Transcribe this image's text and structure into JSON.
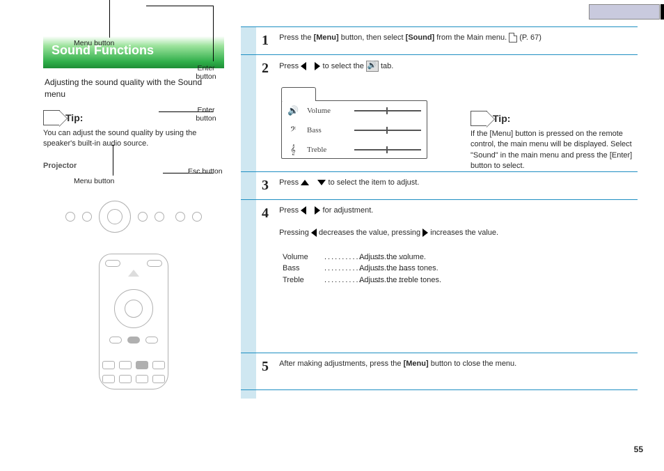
{
  "header": {
    "section_title": "Sound Functions"
  },
  "left": {
    "subtitle": "Adjusting the sound quality with the Sound menu",
    "tip_label": "Tip:",
    "tip_text": "You can adjust the sound quality by using the speaker's built-in audio source.",
    "remote_labels": {
      "top_enter": "Enter button",
      "menu": "Menu button",
      "enter": "Enter button",
      "esc": "Esc button"
    },
    "top_panel_label": "Projector"
  },
  "steps": [
    {
      "n": "1",
      "text_before": "Press the ",
      "bold1": "[Menu]",
      "text_mid": " button, then select ",
      "bold2": "[Sound]",
      "text_after": " from the Main menu. ",
      "doc_ref": " (P. 67)"
    },
    {
      "n": "2",
      "text_before": "Press ",
      "tri": [
        "left",
        "right"
      ],
      "text_after": " to select the ",
      "sound_icon": true,
      "trailing": " tab."
    },
    {
      "n": "3",
      "text_before": "Press ",
      "tri": [
        "up",
        "down"
      ],
      "text_after": " to select the item to adjust."
    },
    {
      "n": "4",
      "text_before": "Press ",
      "tri": [
        "left",
        "right"
      ],
      "text_after": " for adjustment.",
      "extra_line_before": "Pressing ",
      "extra_tri_a": "left",
      "extra_mid": " decreases the value, pressing ",
      "extra_tri_b": "right",
      "extra_after": " increases the value.",
      "sub_menu": [
        {
          "label": "Volume",
          "desc": "Adjusts the volume."
        },
        {
          "label": "Bass",
          "desc": "Adjusts the bass tones."
        },
        {
          "label": "Treble",
          "desc": "Adjusts the treble tones."
        }
      ]
    },
    {
      "n": "5",
      "text_before": "After making adjustments, press the ",
      "bold1": "[Menu]",
      "text_after": " button to close the menu."
    }
  ],
  "osd": {
    "rows": [
      {
        "icon": "🔊",
        "label": "Volume"
      },
      {
        "icon": "𝄢",
        "label": "Bass"
      },
      {
        "icon": "𝄞",
        "label": "Treble"
      }
    ]
  },
  "right_tip": {
    "label": "Tip:",
    "text": "If the [Menu] button is pressed on the remote control, the main menu will be displayed. Select \"Sound\" in the main menu and press the [Enter] button to select."
  },
  "page_number": "55"
}
